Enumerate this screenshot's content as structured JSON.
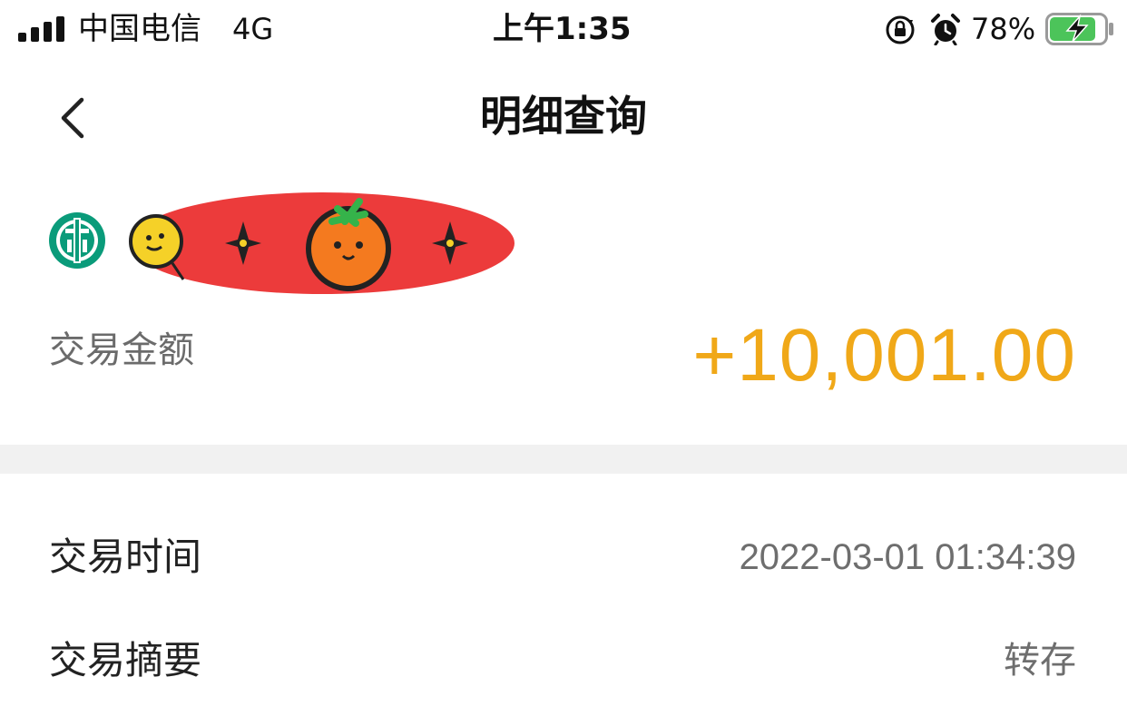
{
  "status_bar": {
    "carrier": "中国电信",
    "network": "4G",
    "time": "上午1:35",
    "battery_percent": "78%",
    "signal_bars": 4,
    "charging": true,
    "icons": [
      "signal-icon",
      "rotation-lock-icon",
      "alarm-icon",
      "battery-charging-icon"
    ]
  },
  "nav": {
    "title": "明细查询",
    "back_icon": "chevron-left-icon"
  },
  "account": {
    "bank_logo_icon": "agricultural-bank-logo-icon",
    "name_redacted": true
  },
  "transaction": {
    "amount_label": "交易金额",
    "amount_value": "+10,001.00",
    "amount_color": "#f0a818",
    "details": [
      {
        "label": "交易时间",
        "value": "2022-03-01 01:34:39"
      },
      {
        "label": "交易摘要",
        "value": "转存"
      }
    ]
  },
  "colors": {
    "accent_amount": "#f0a818",
    "bank_green": "#0a9b7a",
    "divider": "#f1f1f1"
  }
}
